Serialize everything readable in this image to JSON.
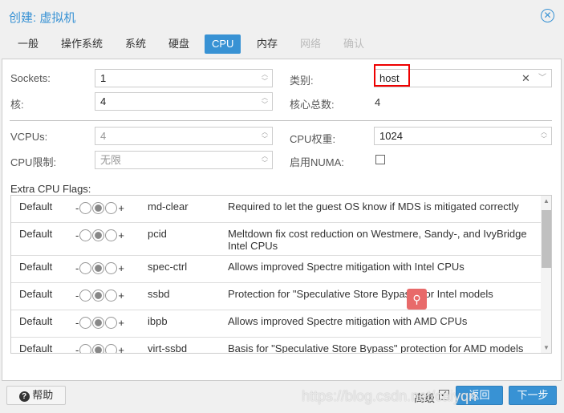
{
  "window": {
    "title": "创建: 虚拟机",
    "close_icon": "close-circle-icon"
  },
  "tabs": [
    {
      "label": "一般"
    },
    {
      "label": "操作系统"
    },
    {
      "label": "系统"
    },
    {
      "label": "硬盘"
    },
    {
      "label": "CPU",
      "active": true
    },
    {
      "label": "内存"
    },
    {
      "label": "网络",
      "disabled": true
    },
    {
      "label": "确认",
      "disabled": true
    }
  ],
  "form": {
    "sockets": {
      "label": "Sockets:",
      "value": "1"
    },
    "cores": {
      "label": "核:",
      "value": "4"
    },
    "type": {
      "label": "类别:",
      "value": "host"
    },
    "total_cores": {
      "label": "核心总数:",
      "value": "4"
    },
    "vcpus": {
      "label": "VCPUs:",
      "value": "4"
    },
    "cpu_weight": {
      "label": "CPU权重:",
      "value": "1024"
    },
    "cpu_limit": {
      "label": "CPU限制:",
      "value": "无限"
    },
    "numa": {
      "label": "启用NUMA:",
      "checked": false
    }
  },
  "flags": {
    "label": "Extra CPU Flags:",
    "rows": [
      {
        "state": "Default",
        "minus": "-",
        "plus": "+",
        "name": "md-clear",
        "desc": "Required to let the guest OS know if MDS is mitigated correctly"
      },
      {
        "state": "Default",
        "minus": "-",
        "plus": "+",
        "name": "pcid",
        "desc": "Meltdown fix cost reduction on Westmere, Sandy-, and IvyBridge Intel CPUs"
      },
      {
        "state": "Default",
        "minus": "-",
        "plus": "+",
        "name": "spec-ctrl",
        "desc": "Allows improved Spectre mitigation with Intel CPUs"
      },
      {
        "state": "Default",
        "minus": "-",
        "plus": "+",
        "name": "ssbd",
        "desc": "Protection for \"Speculative Store Bypass\" for Intel models"
      },
      {
        "state": "Default",
        "minus": "-",
        "plus": "+",
        "name": "ibpb",
        "desc": "Allows improved Spectre mitigation with AMD CPUs"
      },
      {
        "state": "Default",
        "minus": "-",
        "plus": "+",
        "name": "virt-ssbd",
        "desc": "Basis for \"Speculative Store Bypass\" protection for AMD models"
      }
    ]
  },
  "footer": {
    "help": "帮助",
    "advanced": "高级",
    "advanced_checked": true,
    "back": "返回",
    "next": "下一步",
    "watermark": "https://blog.csdn.net/caiyqn"
  },
  "colors": {
    "accent": "#3892d4",
    "highlight": "#e00000"
  }
}
